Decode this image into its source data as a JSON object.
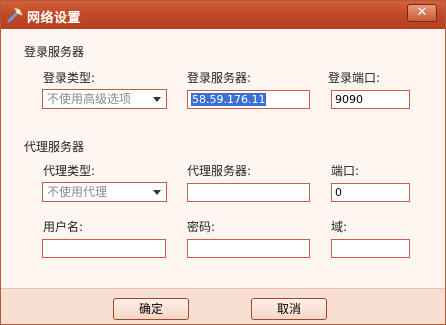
{
  "window": {
    "title": "网络设置",
    "close_glyph": "✕"
  },
  "login_server": {
    "section_title": "登录服务器",
    "login_type_label": "登录类型:",
    "login_type_value": "不使用高级选项",
    "server_label": "登录服务器:",
    "server_value": "58.59.176.11",
    "port_label": "登录端口:",
    "port_value": "9090"
  },
  "proxy_server": {
    "section_title": "代理服务器",
    "proxy_type_label": "代理类型:",
    "proxy_type_value": "不使用代理",
    "server_label": "代理服务器:",
    "server_value": "",
    "port_label": "端口:",
    "port_value": "0",
    "username_label": "用户名:",
    "username_value": "",
    "password_label": "密码:",
    "password_value": "",
    "domain_label": "域:",
    "domain_value": ""
  },
  "footer": {
    "ok_label": "确定",
    "cancel_label": "取消"
  },
  "icons": {
    "app": "tools-icon",
    "close": "close-icon",
    "dropdown": "chevron-down-icon"
  },
  "colors": {
    "titlebar": "#c24a2a",
    "field_border": "#d55a4a",
    "footer_bg": "#f9dfd2",
    "selection": "#3b6fd4"
  }
}
